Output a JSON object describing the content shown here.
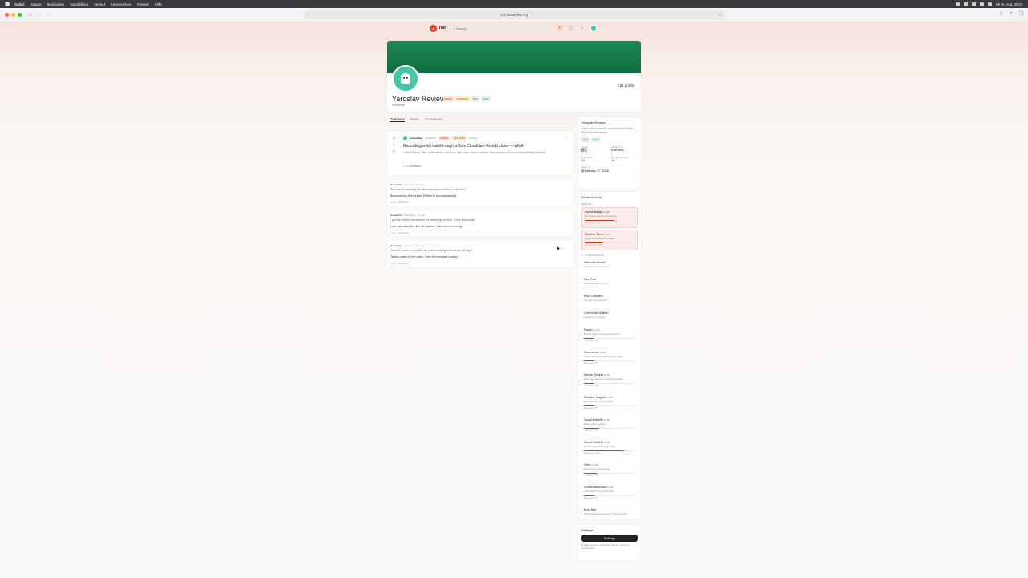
{
  "menubar": {
    "app": "Safari",
    "items": [
      "Ablage",
      "Bearbeiten",
      "Darstellung",
      "Verlauf",
      "Lesezeichen",
      "Fenster",
      "Hilfe"
    ],
    "clock": "Mi. 6. Aug. 20:01"
  },
  "browser": {
    "url": "red.koval-dev.org"
  },
  "header": {
    "brand": "red",
    "search_placeholder": "Search..."
  },
  "profile": {
    "name": "Yaroslav Review",
    "handle": "u/reviewer",
    "edit_label": "Edit profile",
    "badges": [
      "ADMIN",
      "VETERAN",
      "New",
      "Fresh"
    ]
  },
  "tabs": [
    "Overview",
    "Posts",
    "Comments"
  ],
  "post": {
    "score": "1",
    "community": "r/cloudflare",
    "author": "u/reviewer",
    "flairs": [
      "ADMIN",
      "VETERAN"
    ],
    "time": "11h ago",
    "title": "Recording a full walkthrough of this Cloudflare Reddit clone — AMA",
    "body": "I will hit feeds, DMs, notifications, mod tools, and voice rate on camera. Drop questions if you want something covered.",
    "comments": "3 comments"
  },
  "comments": [
    {
      "kind": "Comment",
      "community": "r/general",
      "time": "18m ago",
      "quote": "Who else is watching this allocation drama unfold in real time?",
      "text": "Bookmarking this thread. Perfect B-roll commentary.",
      "footer": "3 pts",
      "reply": "Interacted"
    },
    {
      "kind": "Comment",
      "community": "r/cloudflare",
      "time": "2h ago",
      "quote": "I got rate limited into oblivion for refreshing the feed. Is this intentional?",
      "text": "I will reproduce this live on camera. Talk storm incoming.",
      "footer": "1 pts",
      "reply": "Interacted"
    },
    {
      "kind": "Comment",
      "community": "r/general",
      "time": "14m ago",
      "quote": "Hot take: mode in r/redulev are power-tripping and nobody will say it",
      "text": "Taking notes for the video. Keep the receipts coming.",
      "footer": "2 pts",
      "reply": "Interacted"
    }
  ],
  "about": {
    "name": "Yaroslav Review",
    "description": "Video review account — pokes around feeds, DMs, and notifications.",
    "badges": [
      "New",
      "Fresh"
    ],
    "karma_label": "Karma",
    "karma": "60",
    "redditor_label": "Redditor for",
    "redditor_for": "6 months",
    "post_karma_label": "Post karma",
    "post_karma": "42",
    "comment_karma_label": "Comment karma",
    "comment_karma": "18",
    "cake_label": "Cake day",
    "cake_day": "January 17, 2026"
  },
  "achievements": {
    "title": "Achievements",
    "badges_label": "BADGES",
    "achievements_label": "ACHIEVEMENTS",
    "badges": [
      {
        "name": "Karma Badge",
        "level": "Lv 1/6",
        "desc": "Next badge earned at karma tier",
        "progress_text": "Karma level · 100",
        "progress": 0.6
      },
      {
        "name": "Member Since",
        "level": "Lv 1/6",
        "desc": "Badge earned at account age",
        "progress_text": "Account age · 180",
        "progress": 0.35
      }
    ],
    "items": [
      {
        "name": "Welcome Aboard",
        "level": "",
        "desc": "Completed account set-up",
        "progress_text": "",
        "progress": null
      },
      {
        "name": "First Post",
        "level": "",
        "desc": "Published your first post",
        "progress_text": "",
        "progress": null
      },
      {
        "name": "First Comment",
        "level": "",
        "desc": "Left your first comment",
        "progress_text": "",
        "progress": null
      },
      {
        "name": "Community Builder",
        "level": "",
        "desc": "Created a community",
        "progress_text": "",
        "progress": null
      },
      {
        "name": "Poster",
        "level": "Lv 1/6",
        "desc": "Publish posts to level up this trophy",
        "progress_text": "Next level · 10",
        "progress": 0.2
      },
      {
        "name": "Commenter",
        "level": "Lv 1/6",
        "desc": "Leave comments to level up this trophy",
        "progress_text": "Next level · 25",
        "progress": 0.2
      },
      {
        "name": "Karma Climber",
        "level": "Lv 1/6",
        "desc": "Grow your karma to move up the ladder",
        "progress_text": "Next level · 100",
        "progress": 0.2
      },
      {
        "name": "Follower Magnet",
        "level": "Lv 1/6",
        "desc": "Earn followers on your profile",
        "progress_text": "Next level · 25",
        "progress": 0.2
      },
      {
        "name": "Social Butterfly",
        "level": "Lv 1/6",
        "desc": "Follow other members",
        "progress_text": "Next level · 10",
        "progress": 0.3
      },
      {
        "name": "Crowd Favorite",
        "level": "Lv 4/6",
        "desc": "Have a post reach a high score",
        "progress_text": "Next level · 1000",
        "progress": 0.8
      },
      {
        "name": "Voter",
        "level": "Lv 1/6",
        "desc": "Cast votes across the site",
        "progress_text": "Next level · 50",
        "progress": 0.25
      },
      {
        "name": "Conversationalist",
        "level": "Lv 1/6",
        "desc": "Get replies on your comments",
        "progress_text": "Next level · 10",
        "progress": 0.2
      },
      {
        "name": "Busy Bee",
        "level": "",
        "desc": "Make posts and comments in the same day",
        "progress_text": "",
        "progress": null
      }
    ]
  },
  "settings": {
    "title": "Settings",
    "button": "Settings",
    "description": "Update account, password, theme, privacy & preferences."
  },
  "colors": {
    "accent": "#c4421e",
    "banner": "#1d8a55",
    "avatar": "#44c7a9"
  }
}
